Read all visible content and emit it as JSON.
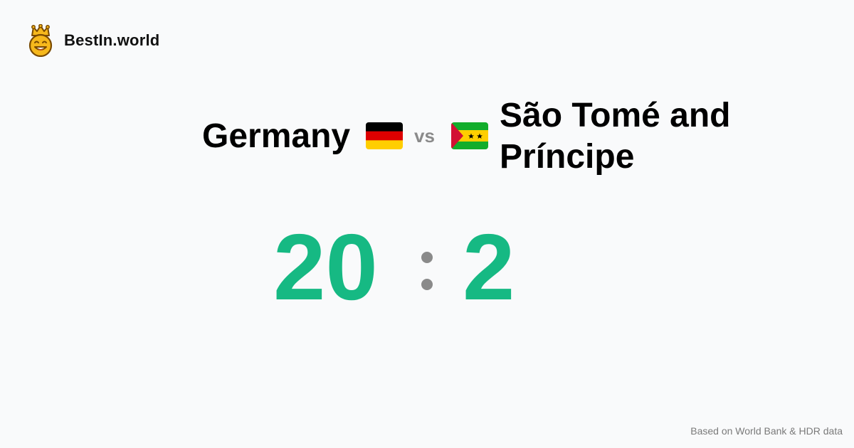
{
  "brand": {
    "name": "BestIn.world",
    "logo_icon": "crowned-smiley-icon"
  },
  "comparison": {
    "left_country": "Germany",
    "left_flag_icon": "germany-flag-icon",
    "vs_label": "vs",
    "right_country": "São Tomé and Príncipe",
    "right_flag_icon": "sao-tome-and-principe-flag-icon"
  },
  "score": {
    "left": "20",
    "right": "2"
  },
  "footer": {
    "source": "Based on World Bank & HDR data"
  },
  "colors": {
    "score": "#16b983",
    "separator": "#8a8a8a",
    "background": "#f9fafb"
  }
}
